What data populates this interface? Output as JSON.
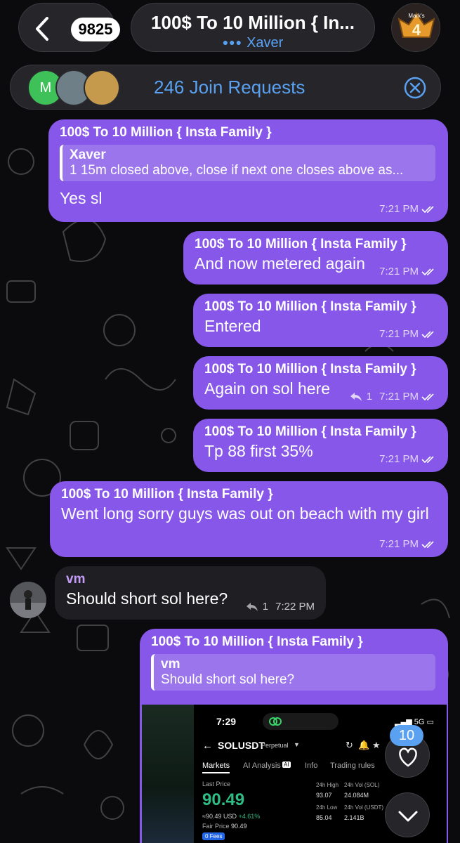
{
  "header": {
    "back_badge": "9825",
    "title": "100$ To 10 Million { In...",
    "subtitle": "Xaver",
    "group_avatar_text": "Mark's"
  },
  "join_bar": {
    "avatar_letter": "M",
    "text": "246 Join Requests"
  },
  "messages": [
    {
      "sender": "100$ To 10 Million { Insta Family }",
      "quote_name": "Xaver",
      "quote_text": "1 15m closed above, close if next one closes above as...",
      "text": "Yes sl",
      "time": "7:21 PM"
    },
    {
      "sender": "100$ To 10 Million { Insta Family }",
      "text": "And now metered again",
      "time": "7:21 PM"
    },
    {
      "sender": "100$ To 10 Million { Insta Family }",
      "text": "Entered",
      "time": "7:21 PM"
    },
    {
      "sender": "100$ To 10 Million { Insta Family }",
      "text": "Again on sol here",
      "replies": "1",
      "time": "7:21 PM"
    },
    {
      "sender": "100$ To 10 Million { Insta Family }",
      "text": "Tp 88 first 35%",
      "time": "7:21 PM"
    },
    {
      "sender": "100$ To 10 Million { Insta Family }",
      "text": "Went long sorry guys was out on beach with my girl",
      "time": "7:21 PM"
    },
    {
      "sender": "vm",
      "text": "Should short sol here?",
      "replies": "1",
      "time": "7:22 PM"
    },
    {
      "sender": "100$ To 10 Million { Insta Family }",
      "quote_name": "vm",
      "quote_text": "Should short sol here?"
    }
  ],
  "screenshot": {
    "time": "7:29",
    "signal": "5G",
    "pair": "SOLUSDT",
    "pair_type": "Perpetual",
    "tabs": [
      "Markets",
      "AI Analysis",
      "Info",
      "Trading rules"
    ],
    "ai_badge": "AI",
    "last_price_label": "Last Price",
    "last_price": "90.49",
    "usd_line": "≈90.49 USD",
    "change": "+4.61%",
    "fair_price_label": "Fair Price",
    "fair_price": "90.49",
    "fees_badge": "0 Fees",
    "high_label": "24h High",
    "high_value": "93.07",
    "vol_sol_label": "24h Vol (SOL)",
    "vol_sol_value": "24.084M",
    "low_label": "24h Low",
    "low_value": "85.04",
    "vol_usdt_label": "24h Vol (USDT)",
    "vol_usdt_value": "2.141B"
  },
  "floating": {
    "reactions_count": "10"
  },
  "colors": {
    "outgoing_bubble": "#8657e8",
    "incoming_bubble": "#1f1f23",
    "accent_blue": "#5aa1f2",
    "price_green": "#2ebd85"
  }
}
